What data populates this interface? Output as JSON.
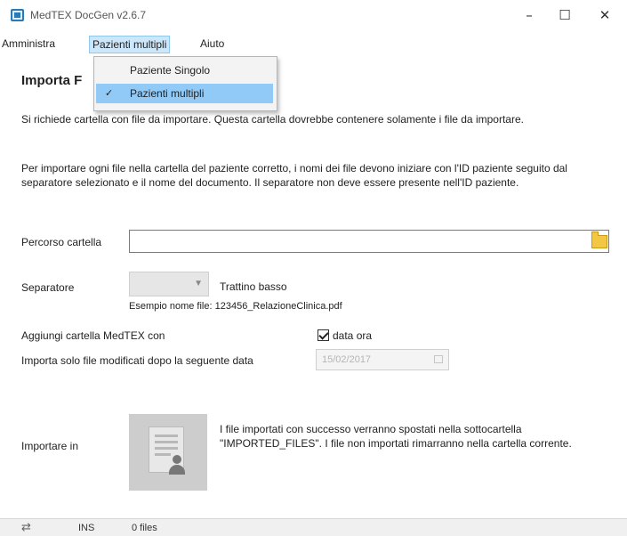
{
  "window": {
    "title": "MedTEX DocGen v2.6.7",
    "minimize_glyph": "–",
    "maximize_glyph": "☐",
    "close_glyph": "✕"
  },
  "menubar": {
    "items": [
      {
        "label": "Amministra"
      },
      {
        "label": "Pazienti multipli"
      },
      {
        "label": "Aiuto"
      }
    ]
  },
  "dropdown": {
    "items": [
      {
        "label": "Paziente Singolo",
        "checked": false
      },
      {
        "label": "Pazienti multipli",
        "checked": true
      }
    ],
    "check_glyph": "✓"
  },
  "page": {
    "heading": "Importa F",
    "para1": "Si richiede cartella con file da importare. Questa cartella dovrebbe contenere solamente i file da importare.",
    "para2": "Per importare ogni file nella cartella del paziente corretto, i nomi dei file devono iniziare con l'ID paziente seguito dal separatore selezionato e il nome del documento. Il separatore non deve essere presente nell'ID paziente."
  },
  "form": {
    "path_label": "Percorso cartella",
    "path_value": "",
    "separator_label": "Separatore",
    "separator_value": "Trattino basso",
    "example_text": "Esempio nome file: 123456_RelazioneClinica.pdf",
    "add_label": "Aggiungi cartella MedTEX con",
    "checkbox_label": "data ora",
    "checkbox_checked": true,
    "modified_label": "Importa solo file modificati dopo la seguente data",
    "date_value": "15/02/2017"
  },
  "import_section": {
    "label": "Importare in",
    "description": "I file importati con successo verranno spostati nella sottocartella \"IMPORTED_FILES\". I file non importati rimarranno nella cartella corrente."
  },
  "statusbar": {
    "icon": "refresh-icon",
    "icon_glyph": "⇄",
    "field1": "INS",
    "field2": "0 files"
  },
  "colors": {
    "menu_highlight": "#cce6fa",
    "dropdown_selected": "#91c9f7",
    "folder_icon": "#f2c744",
    "app_icon": "#2a7ab8"
  }
}
